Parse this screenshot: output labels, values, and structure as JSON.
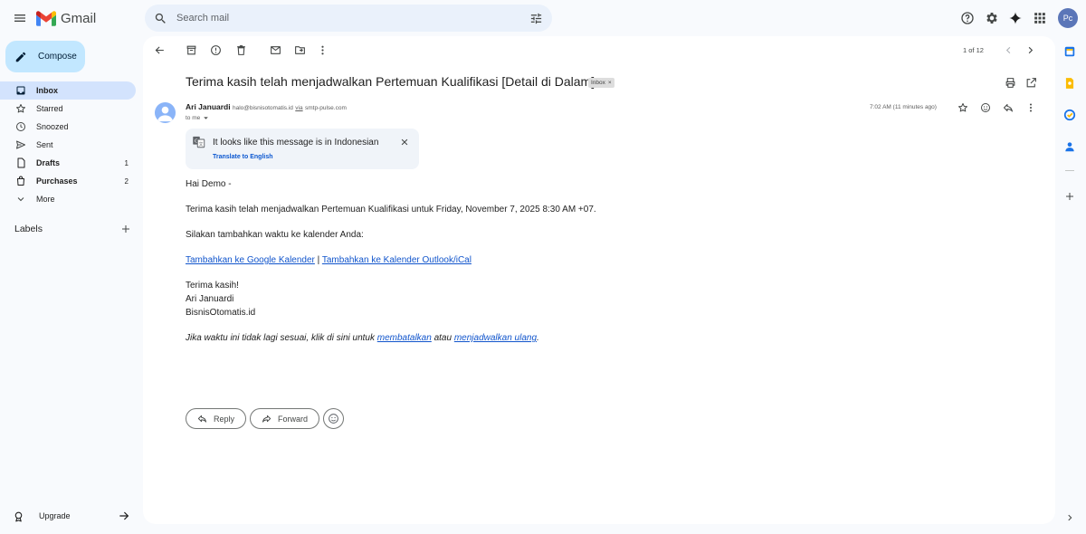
{
  "header": {
    "app_name": "Gmail",
    "search_placeholder": "Search mail",
    "avatar_initials": "Pc"
  },
  "sidebar": {
    "compose_label": "Compose",
    "items": [
      {
        "label": "Inbox",
        "count": "",
        "icon": "inbox-icon"
      },
      {
        "label": "Starred",
        "count": "",
        "icon": "star-icon"
      },
      {
        "label": "Snoozed",
        "count": "",
        "icon": "clock-icon"
      },
      {
        "label": "Sent",
        "count": "",
        "icon": "send-icon"
      },
      {
        "label": "Drafts",
        "count": "1",
        "icon": "draft-icon"
      },
      {
        "label": "Purchases",
        "count": "2",
        "icon": "purchases-icon"
      },
      {
        "label": "More",
        "count": "",
        "icon": "chevron-down-icon"
      }
    ],
    "labels_heading": "Labels",
    "upgrade_label": "Upgrade"
  },
  "toolbar": {
    "page_count": "1 of 12"
  },
  "message": {
    "subject": "Terima kasih telah menjadwalkan Pertemuan Kualifikasi [Detail di Dalam]",
    "label_chip": "Inbox",
    "sender_name": "Ari Januardi",
    "sender_email": "halo@bisnisotomatis.id",
    "via_word": "via",
    "via_domain": "smtp-pulse.com",
    "to": "to me",
    "time": "7:02 AM (11 minutes ago)"
  },
  "translate": {
    "title": "It looks like this message is in Indonesian",
    "link": "Translate to English"
  },
  "body": {
    "greeting": "Hai Demo -",
    "line1": "Terima kasih telah menjadwalkan Pertemuan Kualifikasi untuk Friday, November 7, 2025 8:30 AM +07.",
    "line2": "Silakan tambahkan waktu ke kalender Anda:",
    "link_google": "Tambahkan ke Google Kalender",
    "separator": " | ",
    "link_outlook": "Tambahkan ke Kalender Outlook/iCal",
    "thanks": "Terima kasih!",
    "sign_name": "Ari Januardi",
    "sign_company": "BisnisOtomatis.id",
    "footer_pre": "Jika waktu ini tidak lagi sesuai, klik di sini untuk ",
    "footer_link1": "membatalkan",
    "footer_mid": " atau ",
    "footer_link2": "menjadwalkan ulang",
    "footer_post": "."
  },
  "actions": {
    "reply": "Reply",
    "forward": "Forward"
  },
  "colors": {
    "background": "#f8fafd",
    "compose": "#c2e7ff",
    "active_nav": "#d3e3fd",
    "link": "#1155cc",
    "gmail_red": "#ea4335"
  }
}
